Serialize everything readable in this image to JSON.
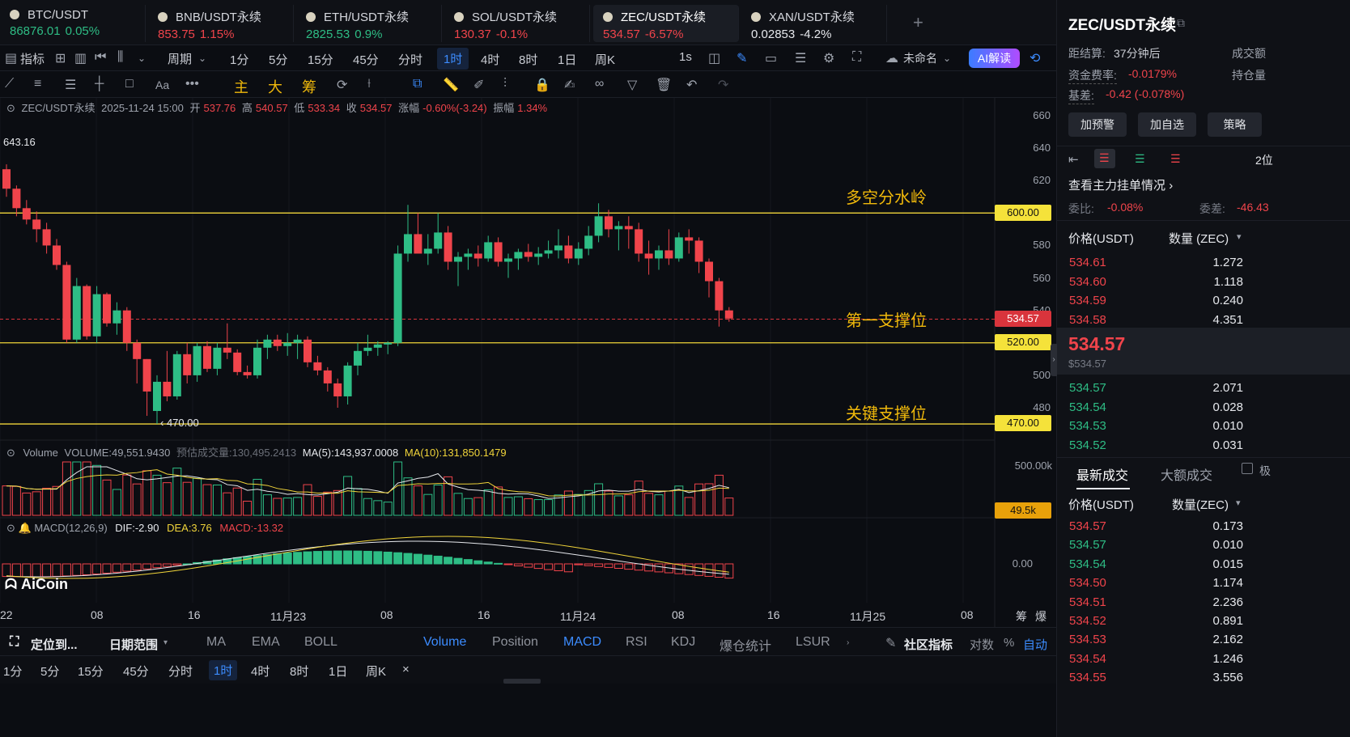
{
  "tabs": [
    {
      "name": "BTC/USDT",
      "price": "86876.01",
      "change": "0.05%",
      "dir": "up"
    },
    {
      "name": "BNB/USDT永续",
      "price": "853.75",
      "change": "1.15%",
      "dir": "dn"
    },
    {
      "name": "ETH/USDT永续",
      "price": "2825.53",
      "change": "0.9%",
      "dir": "up"
    },
    {
      "name": "SOL/USDT永续",
      "price": "130.37",
      "change": "-0.1%",
      "dir": "dn"
    },
    {
      "name": "ZEC/USDT永续",
      "price": "534.57",
      "change": "-6.57%",
      "dir": "dn"
    },
    {
      "name": "XAN/USDT永续",
      "price": "0.02853",
      "change": "-4.2%",
      "dir": "neutral"
    }
  ],
  "toolbar": {
    "indicators": "指标",
    "period": "周期",
    "intervals": [
      "1分",
      "5分",
      "15分",
      "45分",
      "分时",
      "1时",
      "4时",
      "8时",
      "1日",
      "周K"
    ],
    "selected_interval": "1时",
    "second": "1s",
    "unnamed": "未命名",
    "ai": "AI解读",
    "draw_main": "主",
    "draw_big": "大",
    "draw_chip": "筹"
  },
  "chart_header": {
    "symbol": "ZEC/USDT永续",
    "datetime": "2025-11-24 15:00",
    "open_label": "开",
    "open": "537.76",
    "high_label": "高",
    "high": "540.57",
    "low_label": "低",
    "low": "533.34",
    "close_label": "收",
    "close": "534.57",
    "change_label": "涨幅",
    "change": "-0.60%(-3.24)",
    "amp_label": "振幅",
    "amp": "1.34%"
  },
  "chart_labels": {
    "high_marker": "643.16",
    "low_marker": "470.00",
    "divider": "多空分水岭",
    "support1": "第一支撑位",
    "key_support": "关键支撑位",
    "line_600": "600.00",
    "line_520": "520.00",
    "line_470": "470.00",
    "last_price": "534.57",
    "watermark": "AiCoin"
  },
  "volume_header": {
    "title": "Volume",
    "vol": "VOLUME:49,551.9430",
    "est": "预估成交量:130,495.2413",
    "ma5": "MA(5):143,937.0008",
    "ma10": "MA(10):131,850.1479",
    "axis_top": "500.00k",
    "last": "49.5k"
  },
  "macd_header": {
    "title": "MACD(12,26,9)",
    "dif": "DIF:-2.90",
    "dea": "DEA:3.76",
    "macd": "MACD:-13.32",
    "zero": "0.00"
  },
  "x_ticks": [
    "22",
    "08",
    "16",
    "11月23",
    "08",
    "16",
    "11月24",
    "08",
    "16",
    "11月25",
    "08"
  ],
  "x_corner": [
    "筹",
    "爆"
  ],
  "bottom_bar": {
    "locate": "定位到...",
    "date_range": "日期范围",
    "main_ind": [
      "MA",
      "EMA",
      "BOLL"
    ],
    "sub_ind": [
      "Volume",
      "Position",
      "MACD",
      "RSI",
      "KDJ",
      "爆仓统计",
      "LSUR"
    ],
    "community": "社区指标",
    "log": "对数",
    "pct": "%",
    "auto": "自动"
  },
  "bottom_intervals": [
    "1分",
    "5分",
    "15分",
    "45分",
    "分时",
    "1时",
    "4时",
    "8时",
    "1日",
    "周K"
  ],
  "chart_data": {
    "type": "candlestick",
    "y_range": [
      460,
      670
    ],
    "y_ticks": [
      660,
      640,
      620,
      600,
      580,
      560,
      540,
      520,
      500,
      480
    ],
    "horizontal_levels": [
      600,
      520,
      470
    ],
    "last_price": 534.57,
    "candles": [
      [
        627,
        630,
        610,
        615
      ],
      [
        615,
        617,
        598,
        603
      ],
      [
        603,
        608,
        593,
        596
      ],
      [
        596,
        601,
        582,
        590
      ],
      [
        590,
        594,
        575,
        580
      ],
      [
        580,
        584,
        565,
        568
      ],
      [
        568,
        570,
        520,
        522
      ],
      [
        522,
        560,
        520,
        555
      ],
      [
        555,
        556,
        522,
        524
      ],
      [
        524,
        555,
        520,
        550
      ],
      [
        550,
        551,
        530,
        532
      ],
      [
        532,
        545,
        525,
        540
      ],
      [
        540,
        542,
        515,
        520
      ],
      [
        520,
        522,
        495,
        510
      ],
      [
        510,
        510,
        475,
        490
      ],
      [
        478,
        500,
        470,
        496
      ],
      [
        496,
        515,
        484,
        487
      ],
      [
        487,
        515,
        485,
        513
      ],
      [
        513,
        520,
        495,
        500
      ],
      [
        500,
        520,
        496,
        518
      ],
      [
        518,
        521,
        502,
        504
      ],
      [
        504,
        520,
        500,
        517
      ],
      [
        517,
        532,
        510,
        514
      ],
      [
        514,
        516,
        500,
        502
      ],
      [
        502,
        506,
        498,
        500
      ],
      [
        500,
        522,
        498,
        517
      ],
      [
        517,
        525,
        510,
        522
      ],
      [
        522,
        525,
        515,
        518
      ],
      [
        518,
        526,
        512,
        520
      ],
      [
        520,
        525,
        510,
        522
      ],
      [
        522,
        524,
        505,
        508
      ],
      [
        508,
        512,
        500,
        503
      ],
      [
        503,
        505,
        490,
        495
      ],
      [
        495,
        498,
        480,
        487
      ],
      [
        487,
        508,
        482,
        506
      ],
      [
        506,
        520,
        500,
        515
      ],
      [
        515,
        525,
        512,
        517
      ],
      [
        517,
        521,
        512,
        519
      ],
      [
        519,
        521,
        513,
        520
      ],
      [
        520,
        580,
        518,
        575
      ],
      [
        575,
        605,
        570,
        587
      ],
      [
        587,
        600,
        580,
        575
      ],
      [
        575,
        587,
        568,
        578
      ],
      [
        578,
        600,
        575,
        588
      ],
      [
        588,
        592,
        565,
        570
      ],
      [
        570,
        576,
        555,
        573
      ],
      [
        573,
        578,
        565,
        575
      ],
      [
        575,
        580,
        567,
        572
      ],
      [
        572,
        586,
        570,
        582
      ],
      [
        582,
        585,
        567,
        570
      ],
      [
        570,
        575,
        560,
        572
      ],
      [
        572,
        578,
        565,
        576
      ],
      [
        576,
        581,
        570,
        573
      ],
      [
        573,
        579,
        568,
        575
      ],
      [
        575,
        583,
        572,
        577
      ],
      [
        577,
        590,
        572,
        580
      ],
      [
        580,
        586,
        569,
        572
      ],
      [
        572,
        582,
        568,
        578
      ],
      [
        578,
        592,
        574,
        586
      ],
      [
        586,
        606,
        582,
        598
      ],
      [
        598,
        602,
        585,
        590
      ],
      [
        590,
        595,
        577,
        592
      ],
      [
        592,
        598,
        578,
        590
      ],
      [
        590,
        594,
        570,
        575
      ],
      [
        575,
        583,
        562,
        572
      ],
      [
        572,
        580,
        565,
        577
      ],
      [
        577,
        590,
        568,
        572
      ],
      [
        572,
        588,
        570,
        585
      ],
      [
        585,
        590,
        575,
        583
      ],
      [
        583,
        585,
        563,
        570
      ],
      [
        570,
        572,
        548,
        558
      ],
      [
        558,
        560,
        530,
        540
      ],
      [
        540,
        542,
        533,
        535
      ]
    ]
  },
  "right_panel": {
    "title": "ZEC/USDT永续",
    "settle_label": "距结算:",
    "settle": "37分钟后",
    "volume_label": "成交额",
    "funding_label": "资金费率:",
    "funding": "-0.0179%",
    "position_label": "持仓量",
    "basis_label": "基差:",
    "basis": "-0.42 (-0.078%)",
    "buttons": [
      "加预警",
      "加自选",
      "策略"
    ],
    "depth_count": "2位",
    "main_orders": "查看主力挂单情况",
    "ratio_label": "委比:",
    "ratio": "-0.08%",
    "diff_label": "委差:",
    "diff": "-46.43",
    "ob_header": {
      "price": "价格(USDT)",
      "qty": "数量 (ZEC)"
    },
    "asks": [
      [
        "534.61",
        "1.272"
      ],
      [
        "534.60",
        "1.118"
      ],
      [
        "534.59",
        "0.240"
      ],
      [
        "534.58",
        "4.351"
      ]
    ],
    "mid_price": "534.57",
    "mid_sub": "$534.57",
    "bids": [
      [
        "534.57",
        "2.071"
      ],
      [
        "534.54",
        "0.028"
      ],
      [
        "534.53",
        "0.010"
      ],
      [
        "534.52",
        "0.031"
      ]
    ],
    "trade_tabs": [
      "最新成交",
      "大额成交"
    ],
    "trade_header": {
      "price": "价格(USDT)",
      "qty": "数量(ZEC)"
    },
    "trades": [
      [
        "534.57",
        "0.173",
        "dn"
      ],
      [
        "534.57",
        "0.010",
        "up"
      ],
      [
        "534.54",
        "0.015",
        "up"
      ],
      [
        "534.50",
        "1.174",
        "dn"
      ],
      [
        "534.51",
        "2.236",
        "dn"
      ],
      [
        "534.52",
        "0.891",
        "dn"
      ],
      [
        "534.53",
        "2.162",
        "dn"
      ],
      [
        "534.54",
        "1.246",
        "dn"
      ],
      [
        "534.55",
        "3.556",
        "dn"
      ]
    ]
  },
  "colors": {
    "up": "#2ebd85",
    "down": "#f0444b",
    "accent": "#3c8cff",
    "level": "#f0b90b"
  }
}
